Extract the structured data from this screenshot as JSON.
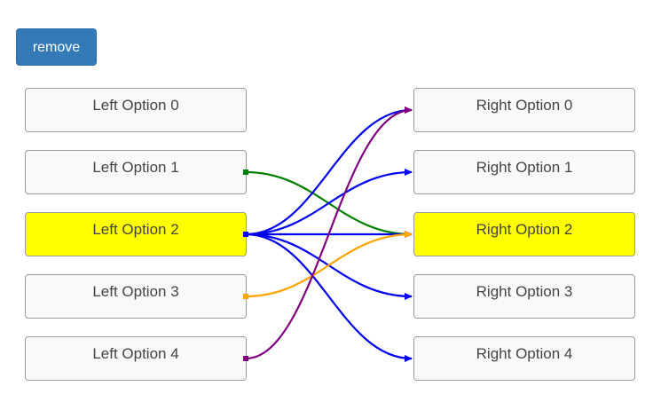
{
  "toolbar": {
    "remove_label": "remove"
  },
  "left_options": [
    {
      "label": "Left Option 0",
      "selected": false
    },
    {
      "label": "Left Option 1",
      "selected": false
    },
    {
      "label": "Left Option 2",
      "selected": true
    },
    {
      "label": "Left Option 3",
      "selected": false
    },
    {
      "label": "Left Option 4",
      "selected": false
    }
  ],
  "right_options": [
    {
      "label": "Right Option 0",
      "selected": false
    },
    {
      "label": "Right Option 1",
      "selected": false
    },
    {
      "label": "Right Option 2",
      "selected": true
    },
    {
      "label": "Right Option 3",
      "selected": false
    },
    {
      "label": "Right Option 4",
      "selected": false
    }
  ],
  "connections": [
    {
      "from": 1,
      "to": 2,
      "color": "#008000"
    },
    {
      "from": 2,
      "to": 0,
      "color": "#0000ee"
    },
    {
      "from": 2,
      "to": 1,
      "color": "#0000ee"
    },
    {
      "from": 2,
      "to": 2,
      "color": "#0000ee"
    },
    {
      "from": 2,
      "to": 3,
      "color": "#0000ee"
    },
    {
      "from": 2,
      "to": 4,
      "color": "#0000ee"
    },
    {
      "from": 3,
      "to": 2,
      "color": "#ffa500"
    },
    {
      "from": 4,
      "to": 0,
      "color": "#800080"
    }
  ],
  "colors": {
    "highlight": "#ffff00",
    "button": "#337ab7"
  }
}
